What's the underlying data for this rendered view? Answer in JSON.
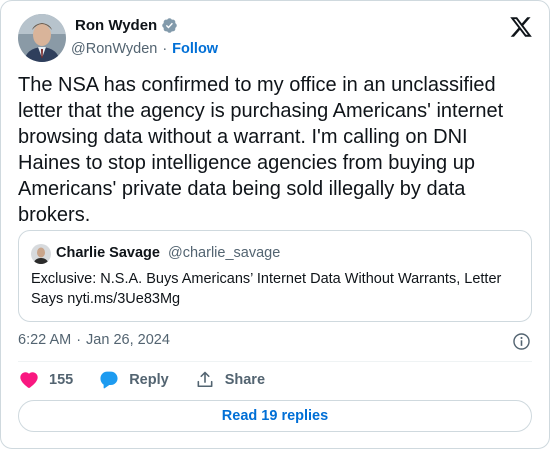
{
  "author": {
    "name": "Ron Wyden",
    "handle": "@RonWyden",
    "separator": "·",
    "follow_label": "Follow",
    "verified_icon": "verified-badge-icon",
    "verified_color": "#829aab"
  },
  "tweet": {
    "text": "The NSA has confirmed to my office in an unclassified\nletter that the agency is purchasing Americans' internet\nbrowsing data without a warrant. I'm calling on DNI\nHaines to stop intelligence agencies from buying up\nAmericans' private data being sold illegally by data\nbrokers."
  },
  "quote": {
    "name": "Charlie Savage",
    "handle": "@charlie_savage",
    "text": "Exclusive: N.S.A. Buys Americans’ Internet Data Without Warrants, Letter\nSays nyti.ms/3Ue83Mg"
  },
  "meta": {
    "time": "6:22 AM",
    "separator": "·",
    "date": "Jan 26, 2024"
  },
  "actions": {
    "like_count": "155",
    "reply_label": "Reply",
    "share_label": "Share",
    "like_icon": "heart-icon",
    "reply_icon": "speech-bubble-icon",
    "share_icon": "share-icon",
    "like_color": "#f91880",
    "reply_color": "#1d9bf0"
  },
  "read_replies_label": "Read 19 replies",
  "colors": {
    "text": "#0f1419",
    "secondary": "#536471",
    "link": "#006fd6",
    "border": "#cfd9de"
  }
}
